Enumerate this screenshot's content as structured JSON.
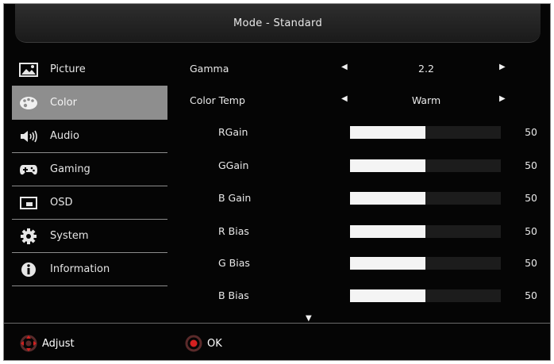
{
  "header": {
    "title": "Mode - Standard"
  },
  "sidebar": {
    "items": [
      {
        "label": "Picture",
        "icon": "picture-icon"
      },
      {
        "label": "Color",
        "icon": "palette-icon",
        "active": true
      },
      {
        "label": "Audio",
        "icon": "speaker-icon"
      },
      {
        "label": "Gaming",
        "icon": "gamepad-icon"
      },
      {
        "label": "OSD",
        "icon": "osd-icon"
      },
      {
        "label": "System",
        "icon": "gear-icon"
      },
      {
        "label": "Information",
        "icon": "info-icon"
      }
    ]
  },
  "settings": {
    "gamma": {
      "label": "Gamma",
      "value": "2.2"
    },
    "color_temp": {
      "label": "Color Temp",
      "value": "Warm"
    },
    "sliders": [
      {
        "label": "RGain",
        "value": "50",
        "level": 0.5
      },
      {
        "label": "GGain",
        "value": "50",
        "level": 0.5
      },
      {
        "label": "B Gain",
        "value": "50",
        "level": 0.5
      },
      {
        "label": "R Bias",
        "value": "50",
        "level": 0.5
      },
      {
        "label": "G Bias",
        "value": "50",
        "level": 0.5
      },
      {
        "label": "B Bias",
        "value": "50",
        "level": 0.5
      }
    ]
  },
  "footer": {
    "adjust_label": "Adjust",
    "ok_label": "OK"
  },
  "colors": {
    "accent": "#d42020",
    "active_bg": "#8e8e8e",
    "bar_fill": "#f4f4f4"
  }
}
